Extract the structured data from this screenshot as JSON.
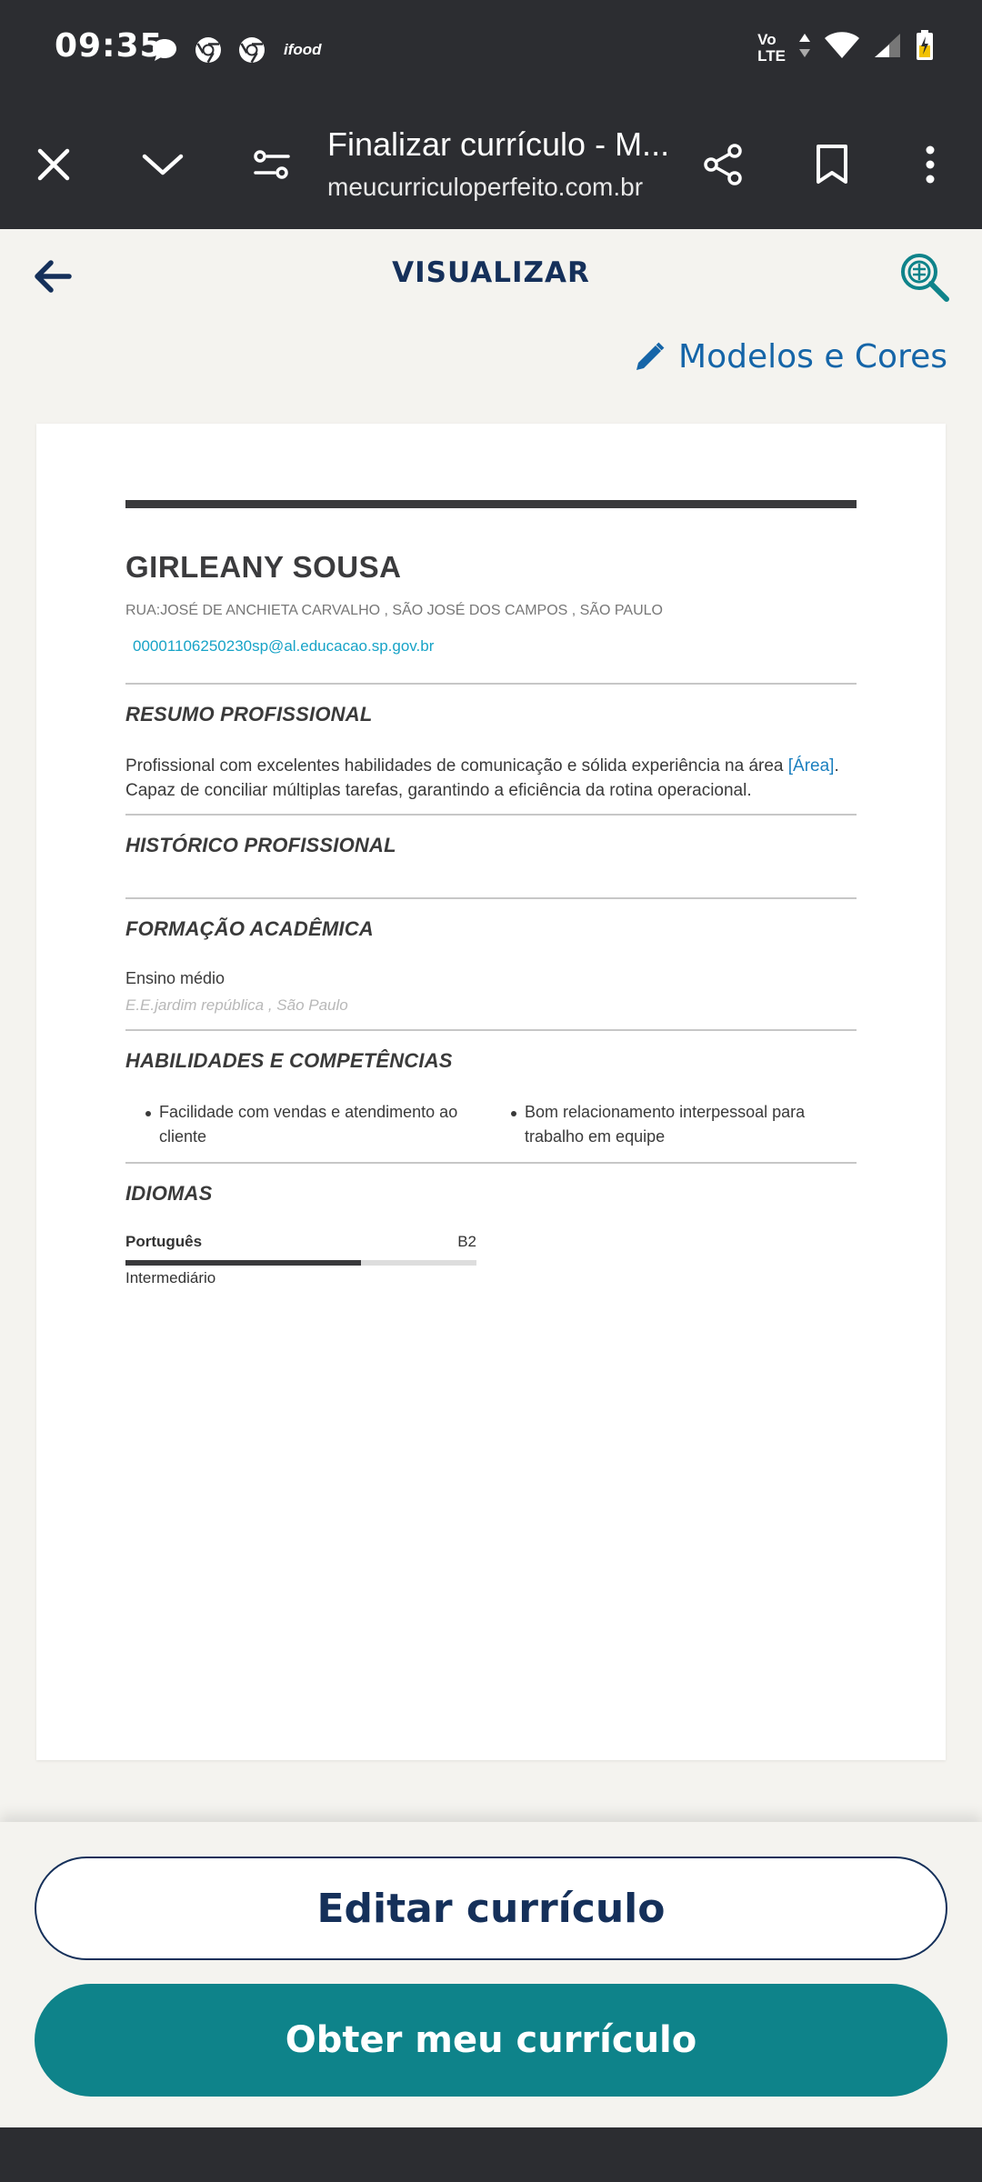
{
  "status_bar": {
    "time": "09:35",
    "notification_icons": [
      "chat-bubble-icon",
      "chrome-icon",
      "chrome-icon",
      "ifood-icon"
    ],
    "ifood_label": "ifood",
    "network_label_1": "Vo",
    "network_label_2": "LTE",
    "right_icons": [
      "volte-icon",
      "data-arrows-icon",
      "wifi-icon",
      "signal-icon",
      "battery-charging-icon"
    ]
  },
  "browser": {
    "page_title": "Finalizar currículo - M...",
    "url": "meucurriculoperfeito.com.br",
    "icons": [
      "close-icon",
      "chevron-down-icon",
      "tune-icon",
      "share-icon",
      "bookmark-icon",
      "more-vert-icon"
    ]
  },
  "header": {
    "title": "VISUALIZAR",
    "models_link": "Modelos e Cores"
  },
  "resume": {
    "name": "GIRLEANY SOUSA",
    "address": "RUA:JOSÉ DE ANCHIETA CARVALHO , SÃO JOSÉ DOS CAMPOS , SÃO PAULO",
    "email": "00001106250230sp@al.educacao.sp.gov.br",
    "summary_title": "RESUMO PROFISSIONAL",
    "summary_text_1": "Profissional com excelentes habilidades de comunicação e sólida experiência na área",
    "summary_highlight": "[Área]",
    "summary_text_2": ". Capaz de conciliar múltiplas tarefas, garantindo a eficiência da rotina operacional.",
    "history_title": "HISTÓRICO PROFISSIONAL",
    "education_title": "FORMAÇÃO ACADÊMICA",
    "education": {
      "degree": "Ensino médio",
      "school": "E.E.jardim república , São Paulo"
    },
    "skills_title": "HABILIDADES E COMPETÊNCIAS",
    "skills": [
      "Facilidade com vendas e atendimento ao cliente",
      "Bom relacionamento interpessoal para trabalho em equipe"
    ],
    "languages_title": "IDIOMAS",
    "languages": [
      {
        "name": "Português",
        "level_code": "B2",
        "level_name": "Intermediário",
        "proficiency": 0.67
      }
    ]
  },
  "actions": {
    "edit_label": "Editar currículo",
    "get_label": "Obter meu currículo"
  },
  "colors": {
    "navy": "#15305a",
    "teal": "#0e838a",
    "link_blue": "#1565a8",
    "email_blue": "#17a3c7",
    "dark_bar": "#2c2d31"
  }
}
